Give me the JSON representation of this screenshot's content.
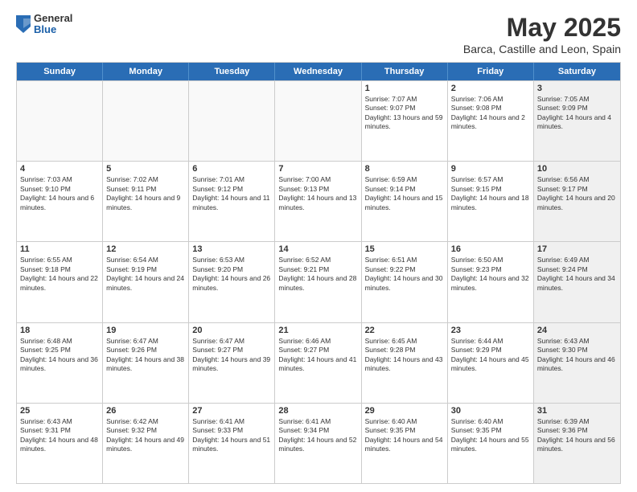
{
  "header": {
    "logo": {
      "general": "General",
      "blue": "Blue"
    },
    "title": "May 2025",
    "subtitle": "Barca, Castille and Leon, Spain"
  },
  "calendar": {
    "days": [
      "Sunday",
      "Monday",
      "Tuesday",
      "Wednesday",
      "Thursday",
      "Friday",
      "Saturday"
    ],
    "weeks": [
      [
        {
          "day": "",
          "empty": true
        },
        {
          "day": "",
          "empty": true
        },
        {
          "day": "",
          "empty": true
        },
        {
          "day": "",
          "empty": true
        },
        {
          "day": "1",
          "sunrise": "Sunrise: 7:07 AM",
          "sunset": "Sunset: 9:07 PM",
          "daylight": "Daylight: 13 hours and 59 minutes."
        },
        {
          "day": "2",
          "sunrise": "Sunrise: 7:06 AM",
          "sunset": "Sunset: 9:08 PM",
          "daylight": "Daylight: 14 hours and 2 minutes."
        },
        {
          "day": "3",
          "shaded": true,
          "sunrise": "Sunrise: 7:05 AM",
          "sunset": "Sunset: 9:09 PM",
          "daylight": "Daylight: 14 hours and 4 minutes."
        }
      ],
      [
        {
          "day": "4",
          "sunrise": "Sunrise: 7:03 AM",
          "sunset": "Sunset: 9:10 PM",
          "daylight": "Daylight: 14 hours and 6 minutes."
        },
        {
          "day": "5",
          "sunrise": "Sunrise: 7:02 AM",
          "sunset": "Sunset: 9:11 PM",
          "daylight": "Daylight: 14 hours and 9 minutes."
        },
        {
          "day": "6",
          "sunrise": "Sunrise: 7:01 AM",
          "sunset": "Sunset: 9:12 PM",
          "daylight": "Daylight: 14 hours and 11 minutes."
        },
        {
          "day": "7",
          "sunrise": "Sunrise: 7:00 AM",
          "sunset": "Sunset: 9:13 PM",
          "daylight": "Daylight: 14 hours and 13 minutes."
        },
        {
          "day": "8",
          "sunrise": "Sunrise: 6:59 AM",
          "sunset": "Sunset: 9:14 PM",
          "daylight": "Daylight: 14 hours and 15 minutes."
        },
        {
          "day": "9",
          "sunrise": "Sunrise: 6:57 AM",
          "sunset": "Sunset: 9:15 PM",
          "daylight": "Daylight: 14 hours and 18 minutes."
        },
        {
          "day": "10",
          "shaded": true,
          "sunrise": "Sunrise: 6:56 AM",
          "sunset": "Sunset: 9:17 PM",
          "daylight": "Daylight: 14 hours and 20 minutes."
        }
      ],
      [
        {
          "day": "11",
          "sunrise": "Sunrise: 6:55 AM",
          "sunset": "Sunset: 9:18 PM",
          "daylight": "Daylight: 14 hours and 22 minutes."
        },
        {
          "day": "12",
          "sunrise": "Sunrise: 6:54 AM",
          "sunset": "Sunset: 9:19 PM",
          "daylight": "Daylight: 14 hours and 24 minutes."
        },
        {
          "day": "13",
          "sunrise": "Sunrise: 6:53 AM",
          "sunset": "Sunset: 9:20 PM",
          "daylight": "Daylight: 14 hours and 26 minutes."
        },
        {
          "day": "14",
          "sunrise": "Sunrise: 6:52 AM",
          "sunset": "Sunset: 9:21 PM",
          "daylight": "Daylight: 14 hours and 28 minutes."
        },
        {
          "day": "15",
          "sunrise": "Sunrise: 6:51 AM",
          "sunset": "Sunset: 9:22 PM",
          "daylight": "Daylight: 14 hours and 30 minutes."
        },
        {
          "day": "16",
          "sunrise": "Sunrise: 6:50 AM",
          "sunset": "Sunset: 9:23 PM",
          "daylight": "Daylight: 14 hours and 32 minutes."
        },
        {
          "day": "17",
          "shaded": true,
          "sunrise": "Sunrise: 6:49 AM",
          "sunset": "Sunset: 9:24 PM",
          "daylight": "Daylight: 14 hours and 34 minutes."
        }
      ],
      [
        {
          "day": "18",
          "sunrise": "Sunrise: 6:48 AM",
          "sunset": "Sunset: 9:25 PM",
          "daylight": "Daylight: 14 hours and 36 minutes."
        },
        {
          "day": "19",
          "sunrise": "Sunrise: 6:47 AM",
          "sunset": "Sunset: 9:26 PM",
          "daylight": "Daylight: 14 hours and 38 minutes."
        },
        {
          "day": "20",
          "sunrise": "Sunrise: 6:47 AM",
          "sunset": "Sunset: 9:27 PM",
          "daylight": "Daylight: 14 hours and 39 minutes."
        },
        {
          "day": "21",
          "sunrise": "Sunrise: 6:46 AM",
          "sunset": "Sunset: 9:27 PM",
          "daylight": "Daylight: 14 hours and 41 minutes."
        },
        {
          "day": "22",
          "sunrise": "Sunrise: 6:45 AM",
          "sunset": "Sunset: 9:28 PM",
          "daylight": "Daylight: 14 hours and 43 minutes."
        },
        {
          "day": "23",
          "sunrise": "Sunrise: 6:44 AM",
          "sunset": "Sunset: 9:29 PM",
          "daylight": "Daylight: 14 hours and 45 minutes."
        },
        {
          "day": "24",
          "shaded": true,
          "sunrise": "Sunrise: 6:43 AM",
          "sunset": "Sunset: 9:30 PM",
          "daylight": "Daylight: 14 hours and 46 minutes."
        }
      ],
      [
        {
          "day": "25",
          "sunrise": "Sunrise: 6:43 AM",
          "sunset": "Sunset: 9:31 PM",
          "daylight": "Daylight: 14 hours and 48 minutes."
        },
        {
          "day": "26",
          "sunrise": "Sunrise: 6:42 AM",
          "sunset": "Sunset: 9:32 PM",
          "daylight": "Daylight: 14 hours and 49 minutes."
        },
        {
          "day": "27",
          "sunrise": "Sunrise: 6:41 AM",
          "sunset": "Sunset: 9:33 PM",
          "daylight": "Daylight: 14 hours and 51 minutes."
        },
        {
          "day": "28",
          "sunrise": "Sunrise: 6:41 AM",
          "sunset": "Sunset: 9:34 PM",
          "daylight": "Daylight: 14 hours and 52 minutes."
        },
        {
          "day": "29",
          "sunrise": "Sunrise: 6:40 AM",
          "sunset": "Sunset: 9:35 PM",
          "daylight": "Daylight: 14 hours and 54 minutes."
        },
        {
          "day": "30",
          "sunrise": "Sunrise: 6:40 AM",
          "sunset": "Sunset: 9:35 PM",
          "daylight": "Daylight: 14 hours and 55 minutes."
        },
        {
          "day": "31",
          "shaded": true,
          "sunrise": "Sunrise: 6:39 AM",
          "sunset": "Sunset: 9:36 PM",
          "daylight": "Daylight: 14 hours and 56 minutes."
        }
      ]
    ]
  }
}
